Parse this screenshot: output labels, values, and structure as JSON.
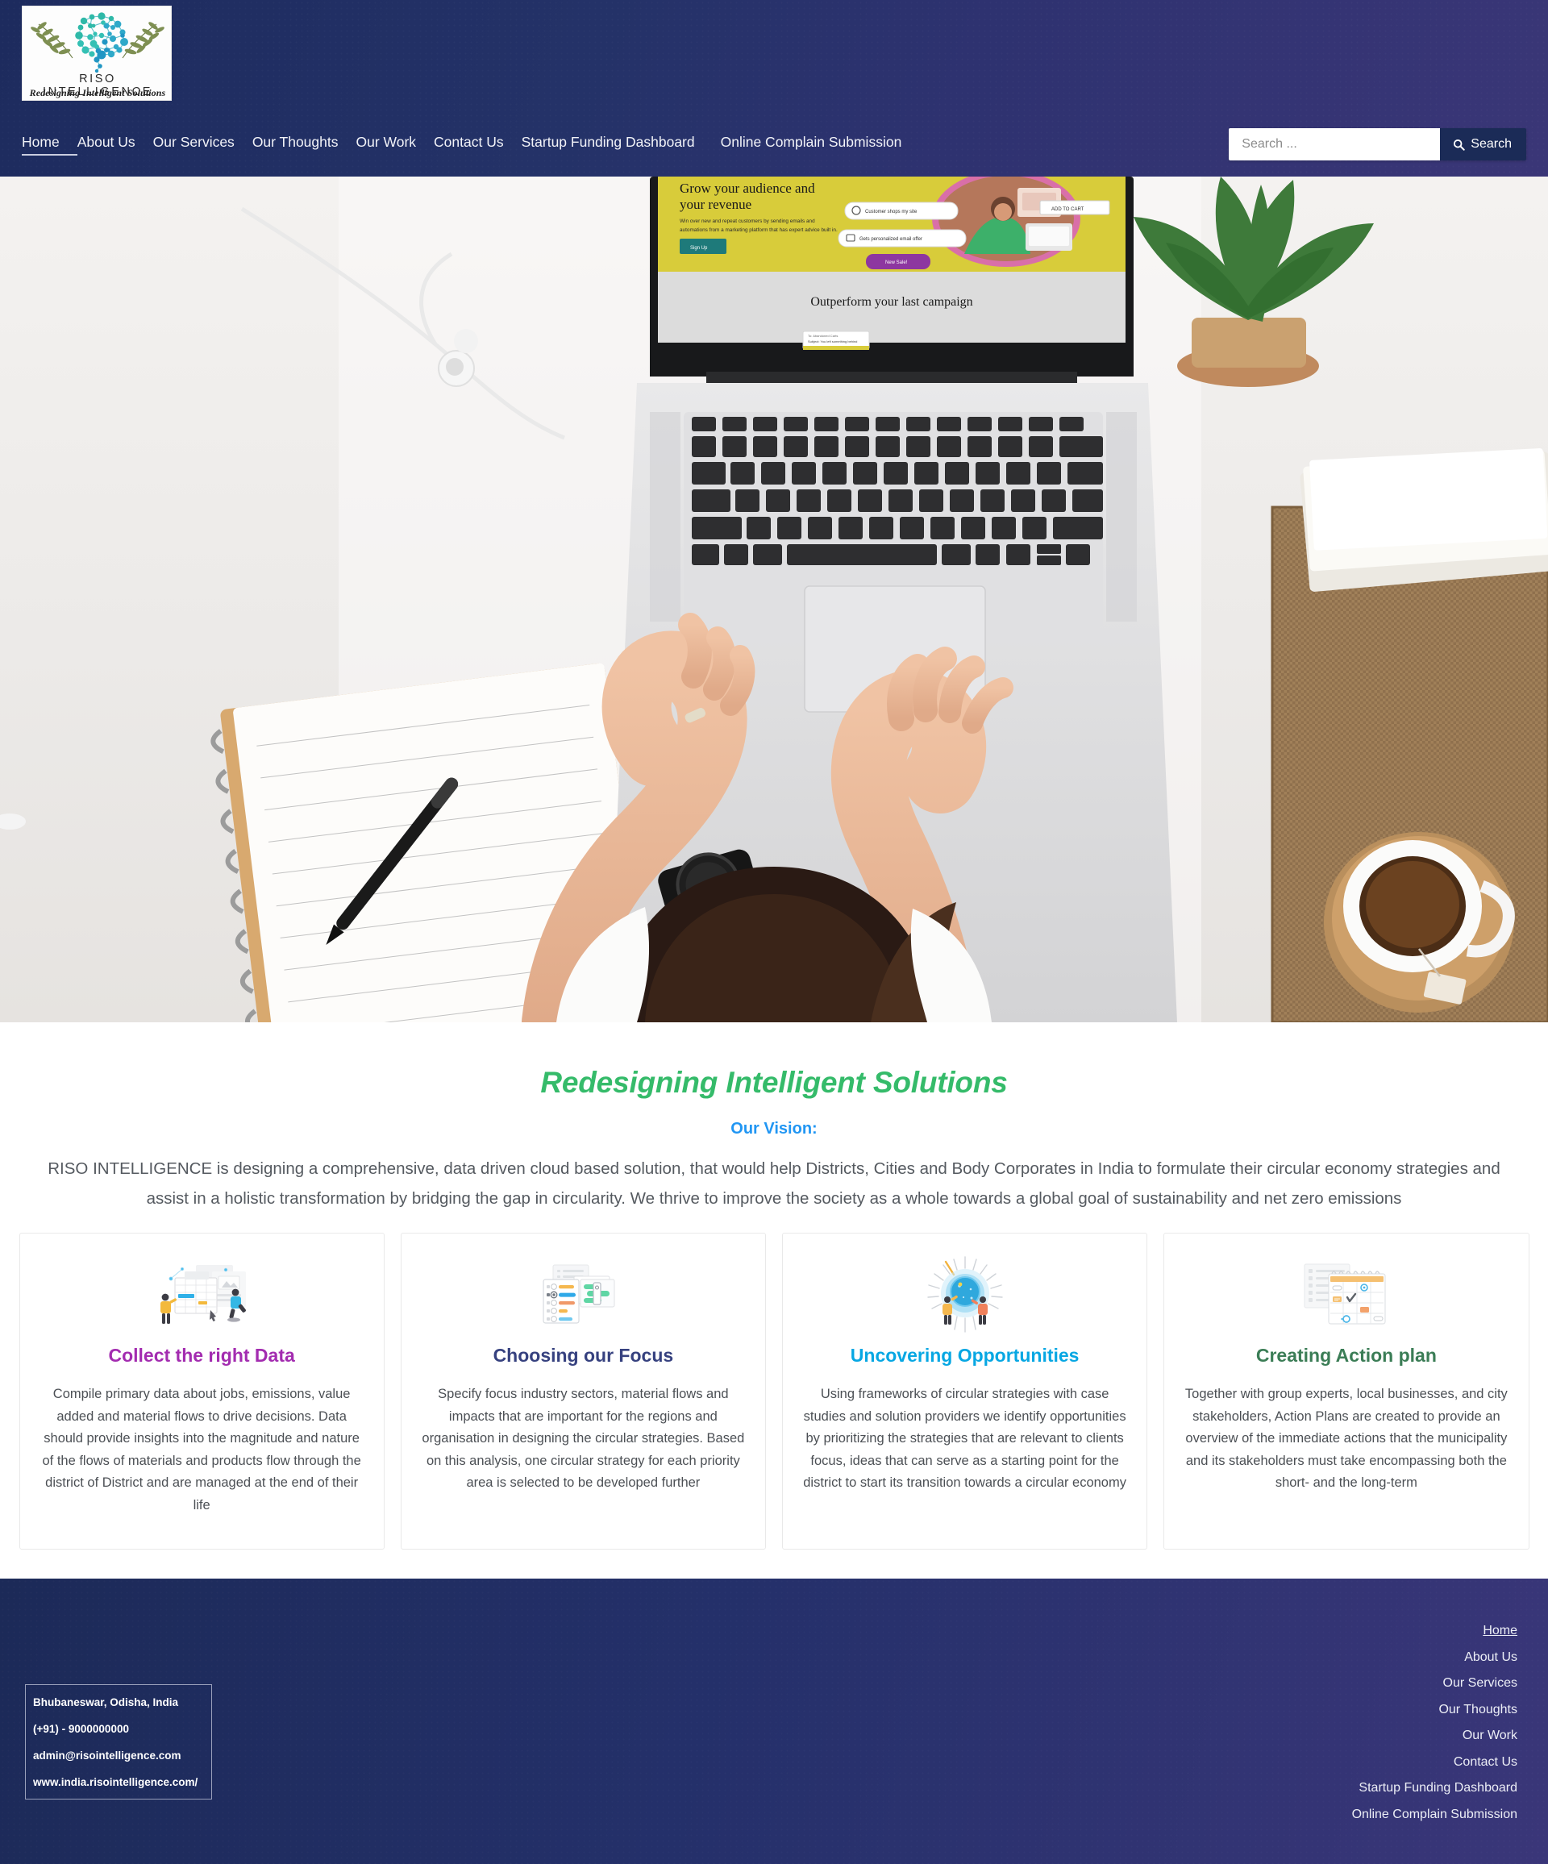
{
  "brand": {
    "name": "RISO INTELLIGENCE",
    "tagline": "Redesigning Intelligent Solutions",
    "logo_icon": "brain-network-olive-branch-logo"
  },
  "header": {
    "nav": [
      {
        "label": "Home",
        "active": true
      },
      {
        "label": "About Us",
        "active": false
      },
      {
        "label": "Our Services",
        "active": false
      },
      {
        "label": "Our Thoughts",
        "active": false
      },
      {
        "label": "Our Work",
        "active": false
      },
      {
        "label": "Contact Us",
        "active": false
      },
      {
        "label": "Startup Funding Dashboard",
        "active": false
      },
      {
        "label": "Online Complain Submission",
        "active": false
      }
    ],
    "search": {
      "placeholder": "Search ...",
      "value": "",
      "button_label": "Search",
      "button_icon": "search-icon"
    },
    "gradient_start": "#1d2b5e",
    "gradient_end": "#3a3677"
  },
  "hero": {
    "alt": "Overhead photo of a person typing on a laptop at a white desk with a notebook, pen, earphones, coffee cup and plant",
    "screen_headline": "Grow your audience and your revenue",
    "screen_subtext": "Win over new and repeat customers by sending emails and automations from a marketing platform that has expert advice built in.",
    "screen_button": "Sign Up",
    "screen_badges": [
      "Customer shops my site",
      "Gets personalized email offer",
      "New Sale!",
      "ADD TO CART"
    ],
    "screen_section_title": "Outperform your last campaign"
  },
  "vision": {
    "title": "Redesigning Intelligent Solutions",
    "subtitle": "Our Vision:",
    "body": "RISO INTELLIGENCE is designing a comprehensive, data driven cloud based solution, that would help Districts, Cities and Body Corporates in India to formulate their circular economy strategies and assist in a holistic transformation by bridging the gap in circularity. We thrive to improve the society as a whole towards a global goal of sustainability and net zero emissions",
    "title_color": "#35bb6a",
    "subtitle_color": "#2196f3"
  },
  "cards": [
    {
      "title": "Collect the right Data",
      "title_color": "#a32cb0",
      "icon": "spreadsheet-data-illustration",
      "body": "Compile primary data about jobs, emissions, value added and material flows to drive decisions. Data should provide insights into the magnitude and nature of the flows of materials and products flow through the district of District and are managed at the end of their life"
    },
    {
      "title": "Choosing our Focus",
      "title_color": "#36417f",
      "icon": "checklist-documents-illustration",
      "body": "Specify focus industry sectors, material flows and impacts that are important for the regions and organisation in designing the circular strategies. Based on this analysis, one circular strategy for each priority area is selected to be developed further"
    },
    {
      "title": "Uncovering Opportunities",
      "title_color": "#07a7e3",
      "icon": "glowing-sphere-discovery-illustration",
      "body": "Using frameworks of circular strategies with case studies and solution providers we identify opportunities by prioritizing the strategies that are relevant to clients focus, ideas that can serve as a starting point for the district to start its transition towards a circular economy"
    },
    {
      "title": "Creating Action plan",
      "title_color": "#3b7d56",
      "icon": "calendar-checklist-illustration",
      "body": "Together with group experts, local businesses, and city stakeholders, Action Plans are created to provide an overview of the immediate actions that the municipality and its stakeholders must take encompassing both the short- and the long-term"
    }
  ],
  "footer": {
    "contact": [
      "Bhubaneswar, Odisha, India",
      "(+91) - 9000000000",
      "admin@risointelligence.com",
      "www.india.risointelligence.com/"
    ],
    "nav": [
      {
        "label": "Home",
        "active": true
      },
      {
        "label": "About Us",
        "active": false
      },
      {
        "label": "Our Services",
        "active": false
      },
      {
        "label": "Our Thoughts",
        "active": false
      },
      {
        "label": "Our Work",
        "active": false
      },
      {
        "label": "Contact Us",
        "active": false
      },
      {
        "label": "Startup Funding Dashboard",
        "active": false
      },
      {
        "label": "Online Complain Submission",
        "active": false
      }
    ],
    "gradient_start": "#1c2a58",
    "gradient_end": "#3a3679"
  }
}
